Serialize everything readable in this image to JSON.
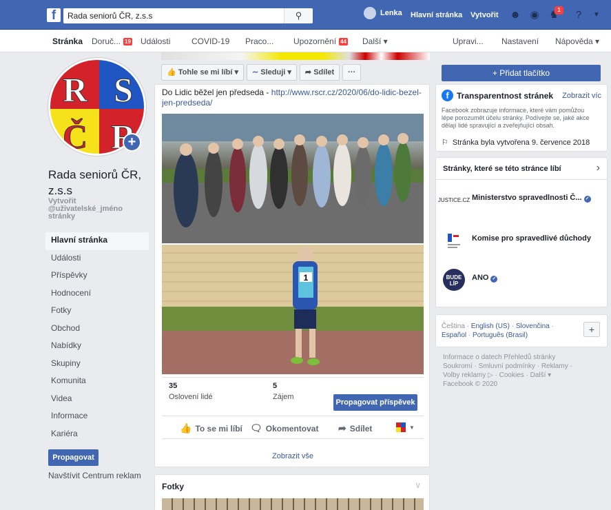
{
  "topbar": {
    "search_value": "Rada seniorů ČR, z.s.s",
    "user_name": "Lenka",
    "home_label": "Hlavní stránka",
    "create_label": "Vytvořit",
    "notifications_count": "1"
  },
  "tabs": [
    {
      "label": "Stránka"
    },
    {
      "label": "Doruč...",
      "badge": "19"
    },
    {
      "label": "Události"
    },
    {
      "label": "COVID-19"
    },
    {
      "label": "Praco..."
    },
    {
      "label": "Upozornění",
      "badge": "44"
    },
    {
      "label": "Další ▾"
    },
    {
      "label": "Upravi..."
    },
    {
      "label": "Nastavení"
    },
    {
      "label": "Nápověda ▾"
    }
  ],
  "page": {
    "name": "Rada seniorů ČR, z.s.s",
    "username_prompt": "Vytvořit @uživatelské_jméno stránky"
  },
  "logo_letters": [
    "R",
    "S",
    "Č",
    "R"
  ],
  "leftnav": [
    "Hlavní stránka",
    "Události",
    "Příspěvky",
    "Hodnocení",
    "Fotky",
    "Obchod",
    "Nabídky",
    "Skupiny",
    "Komunita",
    "Videa",
    "Informace",
    "Kariéra"
  ],
  "promote_label": "Propagovat",
  "ads_center_label": "Navštívit Centrum reklam",
  "actions": {
    "like": "Tohle se mi líbí ▾",
    "follow": "Sleduji ▾",
    "share": "Sdílet",
    "more": "···"
  },
  "post": {
    "text": "Do Lidic běžel jen předseda - ",
    "link": "http://www.rscr.cz/2020/06/do-lidic-bezel-jen-predseda/",
    "reach_value": "35",
    "reach_label": "Oslovení lidé",
    "engagement_value": "5",
    "engagement_label": "Zájem",
    "boost_label": "Propagovat příspěvek",
    "like_label": "To se mi líbí",
    "comment_label": "Okomentovat",
    "share_label": "Sdílet",
    "runner_bib": "1"
  },
  "show_all_label": "Zobrazit vše",
  "photos_title": "Fotky",
  "right": {
    "add_button_label": "+ Přidat tlačítko",
    "transparency_title": "Transparentnost stránek",
    "transparency_more": "Zobrazit víc",
    "transparency_text": "Facebook zobrazuje informace, které vám pomůžou lépe porozumět účelu stránky. Podívejte se, jaké akce dělají lidé spravující a zveřejňující obsah.",
    "created_text": "Stránka byla vytvořena 9. července 2018",
    "likes_title": "Stránky, které se této stránce líbí",
    "liked_pages": [
      {
        "name": "Ministerstvo spravedlnosti Č...",
        "logo": "JUSTICE.CZ",
        "verified": true
      },
      {
        "name": "Komise pro spravedlivé důchody",
        "logo": "",
        "verified": false
      },
      {
        "name": "ANO",
        "logo": "BUDE LÍP",
        "verified": true
      }
    ],
    "lang_current": "Čeština",
    "lang_links": [
      "English (US)",
      "Slovenčina",
      "Español",
      "Português (Brasil)"
    ],
    "footer_line1": "Informace o datech Přehledů stránky",
    "footer_line2": "Soukromí · Smluvní podmínky · Reklamy ·",
    "footer_line3": "Volby reklamy ▷ · Cookies · Další ▾",
    "footer_line4": "Facebook © 2020"
  },
  "colors": {
    "brand": "#4267b2",
    "badge": "#fa3e3e",
    "link": "#385898"
  }
}
